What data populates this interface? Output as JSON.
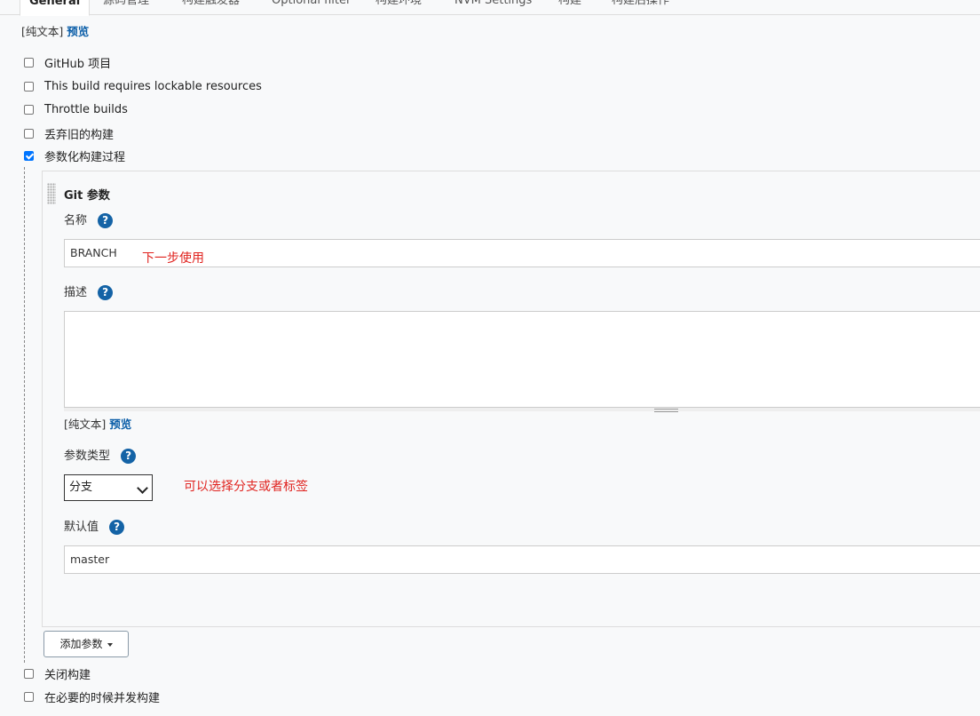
{
  "tabs": [
    {
      "label": "General"
    },
    {
      "label": "源码管理"
    },
    {
      "label": "构建触发器"
    },
    {
      "label": "Optional filter"
    },
    {
      "label": "构建环境"
    },
    {
      "label": "NVM Settings"
    },
    {
      "label": "构建"
    },
    {
      "label": "构建后操作"
    }
  ],
  "top_links": {
    "plain": "[纯文本]",
    "preview": "预览"
  },
  "options": [
    {
      "label": "GitHub 项目",
      "checked": false
    },
    {
      "label": "This build requires lockable resources",
      "checked": false
    },
    {
      "label": "Throttle builds",
      "checked": false
    },
    {
      "label": "丢弃旧的构建",
      "checked": false
    },
    {
      "label": "参数化构建过程",
      "checked": true
    }
  ],
  "param": {
    "title": "Git 参数",
    "name_label": "名称",
    "name_value": "BRANCH",
    "name_annotation": "下一步使用",
    "desc_label": "描述",
    "desc_links": {
      "plain": "[纯文本]",
      "preview": "预览"
    },
    "type_label": "参数类型",
    "type_value": "分支",
    "type_annotation": "可以选择分支或者标签",
    "default_label": "默认值",
    "default_value": "master"
  },
  "add_param_button": "添加参数",
  "bottom_options": [
    {
      "label": "关闭构建",
      "checked": false
    },
    {
      "label": "在必要的时候并发构建",
      "checked": false
    }
  ],
  "help_glyph": "?"
}
